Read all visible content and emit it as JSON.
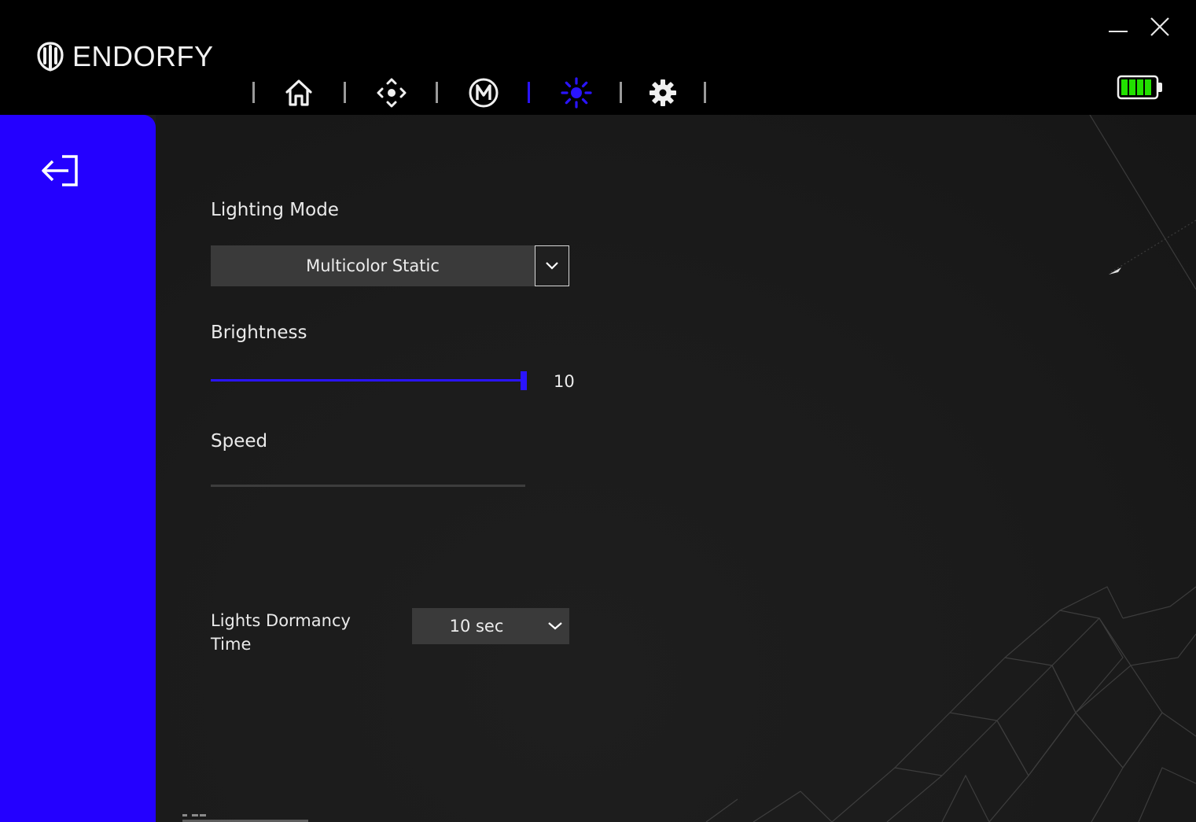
{
  "app": {
    "brand": "ENDORFY",
    "window_controls": {
      "minimize_icon": "minimize-icon",
      "close_icon": "close-icon"
    },
    "battery": {
      "icon": "battery-icon",
      "level": 1.0,
      "color": "#22e000"
    }
  },
  "nav": {
    "items": [
      {
        "id": "home",
        "icon": "home-icon",
        "active": false
      },
      {
        "id": "buttons",
        "icon": "dpad-icon",
        "active": false
      },
      {
        "id": "macro",
        "icon": "macro-m-icon",
        "active": false
      },
      {
        "id": "lighting",
        "icon": "lighting-sun-icon",
        "active": true
      },
      {
        "id": "settings",
        "icon": "gear-icon",
        "active": false
      }
    ],
    "active_color": "#2a14ff"
  },
  "sidebar": {
    "back_icon": "exit-arrow-icon",
    "color": "#2400ff"
  },
  "lighting": {
    "mode_label": "Lighting Mode",
    "mode_value": "Multicolor Static",
    "brightness_label": "Brightness",
    "brightness_value": "10",
    "brightness_fraction": 1.0,
    "speed_label": "Speed",
    "dormancy_label": "Lights Dormancy Time",
    "dormancy_value": "10 sec"
  }
}
